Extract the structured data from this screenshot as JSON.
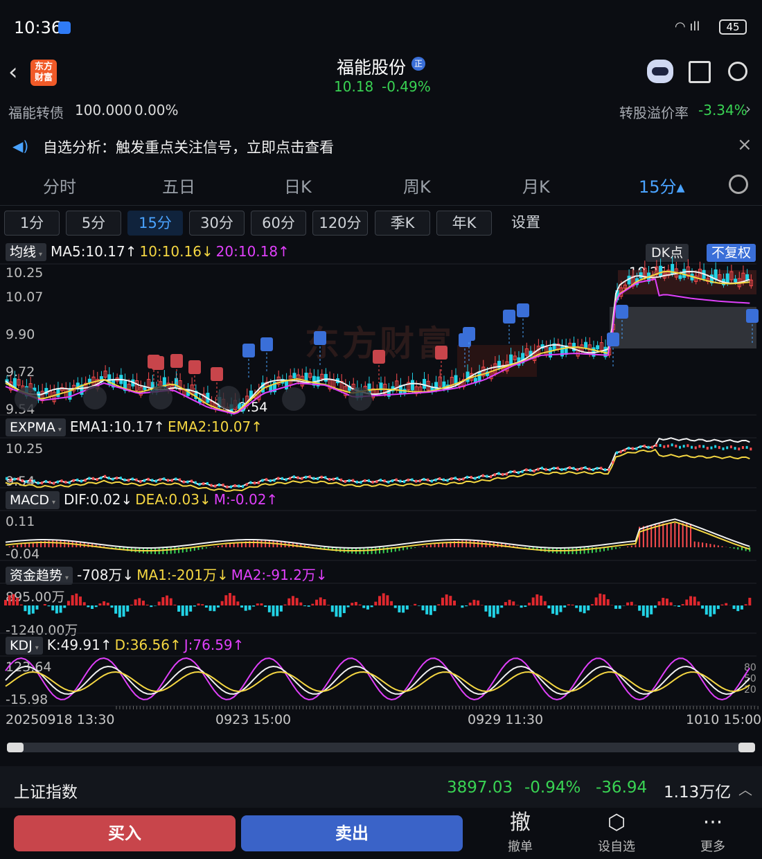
{
  "status": {
    "time": "10:36",
    "battery": "45"
  },
  "header": {
    "logo": "东方\n财富",
    "stock_name": "福能股份",
    "badge": "正",
    "price": "10.18",
    "change_pct": "-0.49%"
  },
  "bond": {
    "name": "福能转债",
    "price": "100.000",
    "change": "0.00%",
    "premium_label": "转股溢价率",
    "premium_value": "-3.34%"
  },
  "notice": {
    "text": "自选分析：触发重点关注信号，立即点击查看"
  },
  "tabs": [
    "分时",
    "五日",
    "日K",
    "周K",
    "月K",
    "15分▴"
  ],
  "period_tabs": [
    "1分",
    "5分",
    "15分",
    "30分",
    "60分",
    "120分",
    "季K",
    "年K",
    "设置"
  ],
  "main": {
    "name": "均线",
    "ma5": "MA5:10.17↑",
    "ma10": "10:10.16↓",
    "ma20": "20:10.18↑",
    "dk": "DK点",
    "fuquan": "不复权",
    "y_labels": [
      "10.25",
      "10.07",
      "9.90",
      "9.72",
      "9.54"
    ],
    "hi_label": "10.25",
    "lo_label": "9.54",
    "watermark": "东方财富"
  },
  "expma": {
    "name": "EXPMA",
    "ema1": "EMA1:10.17↑",
    "ema2": "EMA2:10.07↑",
    "y_top": "10.25",
    "y_bot": "9.54"
  },
  "macd": {
    "name": "MACD",
    "dif": "DIF:0.02↓",
    "dea": "DEA:0.03↓",
    "m": "M:-0.02↑",
    "y_top": "0.11",
    "y_bot": "-0.04"
  },
  "fund": {
    "name": "资金趋势",
    "val": "-708万↓",
    "ma1": "MA1:-201万↓",
    "ma2": "MA2:-91.2万↓",
    "y_top": "895.00万",
    "y_bot": "-1240.00万"
  },
  "kdj": {
    "name": "KDJ",
    "k": "K:49.91↑",
    "d": "D:36.56↑",
    "j": "J:76.59↑",
    "y_top": "123.64",
    "y_bot": "-15.98",
    "r80": "80",
    "r50": "50",
    "r20": "20"
  },
  "x_labels": [
    "20250918 13:30",
    "0923 15:00",
    "0929 11:30",
    "1010 15:00"
  ],
  "index_bar": {
    "name": "上证指数",
    "value": "3897.03",
    "pct": "-0.94%",
    "chg": "-36.94",
    "amount": "1.13万亿"
  },
  "actions": {
    "buy": "买入",
    "sell": "卖出",
    "cancel_icon": "撤",
    "cancel": "撤单",
    "watch": "设自选",
    "more": "更多"
  },
  "colors": {
    "up": "#ff4d4f",
    "down": "#39d353",
    "accent": "#4aa3ff",
    "ma5": "#f2f2f2",
    "ma10": "#f5d742",
    "ma20": "#e040fb"
  }
}
